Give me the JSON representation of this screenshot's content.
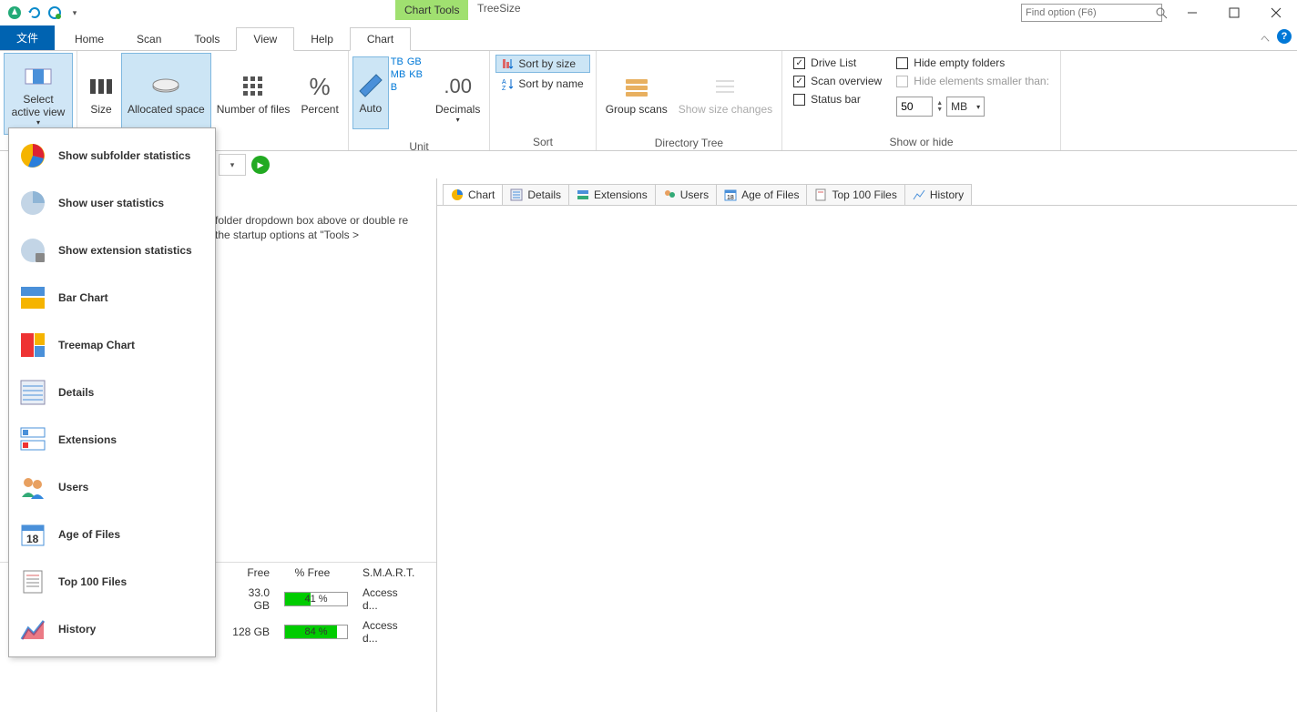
{
  "titlebar": {
    "chart_tools": "Chart Tools",
    "app_title": "TreeSize",
    "search_placeholder": "Find option (F6)"
  },
  "tabs": {
    "file": "文件",
    "home": "Home",
    "scan": "Scan",
    "tools": "Tools",
    "view": "View",
    "help": "Help",
    "chart": "Chart"
  },
  "ribbon": {
    "select_active_view": "Select active view",
    "size": "Size",
    "allocated_space": "Allocated space",
    "number_of_files": "Number of files",
    "percent": "Percent",
    "group_mode": "",
    "auto": "Auto",
    "units": {
      "tb": "TB",
      "gb": "GB",
      "mb": "MB",
      "kb": "KB",
      "b": "B"
    },
    "decimals": "Decimals",
    "unit_group": "Unit",
    "sort_by_size": "Sort by size",
    "sort_by_name": "Sort by name",
    "sort_group": "Sort",
    "group_scans": "Group scans",
    "show_size_changes": "Show size changes",
    "dirtree_group": "Directory Tree",
    "drive_list": "Drive List",
    "scan_overview": "Scan overview",
    "status_bar": "Status bar",
    "hide_empty_folders": "Hide empty folders",
    "hide_smaller_than": "Hide elements smaller than:",
    "hide_value": "50",
    "hide_unit": "MB",
    "showhide_group": "Show or hide"
  },
  "dropdown": {
    "show_subfolder": "Show subfolder statistics",
    "show_user": "Show user statistics",
    "show_extension": "Show extension statistics",
    "bar_chart": "Bar Chart",
    "treemap_chart": "Treemap Chart",
    "details": "Details",
    "extensions": "Extensions",
    "users": "Users",
    "age_of_files": "Age of Files",
    "top_100": "Top 100 Files",
    "history": "History"
  },
  "info_text": "folder dropdown box above or double re the startup options at \"Tools >",
  "drive_table": {
    "headers": {
      "free": "Free",
      "pfree": "% Free",
      "smart": "S.M.A.R.T."
    },
    "rows": [
      {
        "free": "33.0 GB",
        "pfree": "41 %",
        "pct": 41,
        "smart": "Access d..."
      },
      {
        "free": "128 GB",
        "pfree": "84 %",
        "pct": 84,
        "smart": "Access d..."
      }
    ]
  },
  "right_tabs": {
    "chart": "Chart",
    "details": "Details",
    "extensions": "Extensions",
    "users": "Users",
    "age": "Age of Files",
    "top100": "Top 100 Files",
    "history": "History"
  }
}
